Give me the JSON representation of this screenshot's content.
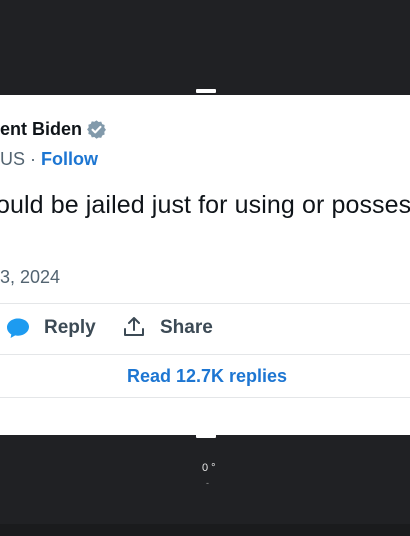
{
  "tweet": {
    "display_name": "ent Biden",
    "handle": "US",
    "separator": " · ",
    "follow_label": "Follow",
    "text": "ould be jailed just for using or posses",
    "date": "3, 2024"
  },
  "actions": {
    "reply_label": "Reply",
    "share_label": "Share",
    "read_replies_label": "Read 12.7K replies"
  },
  "overlay": {
    "caption": "0 °",
    "dot": "-"
  },
  "icons": {
    "verified": "verified-badge-icon",
    "reply": "speech-bubble-icon",
    "share": "share-upload-icon"
  },
  "colors": {
    "link": "#1d76d2",
    "reply_icon": "#1d9bf0",
    "verified_badge": "#829aab",
    "background": "#202124"
  }
}
